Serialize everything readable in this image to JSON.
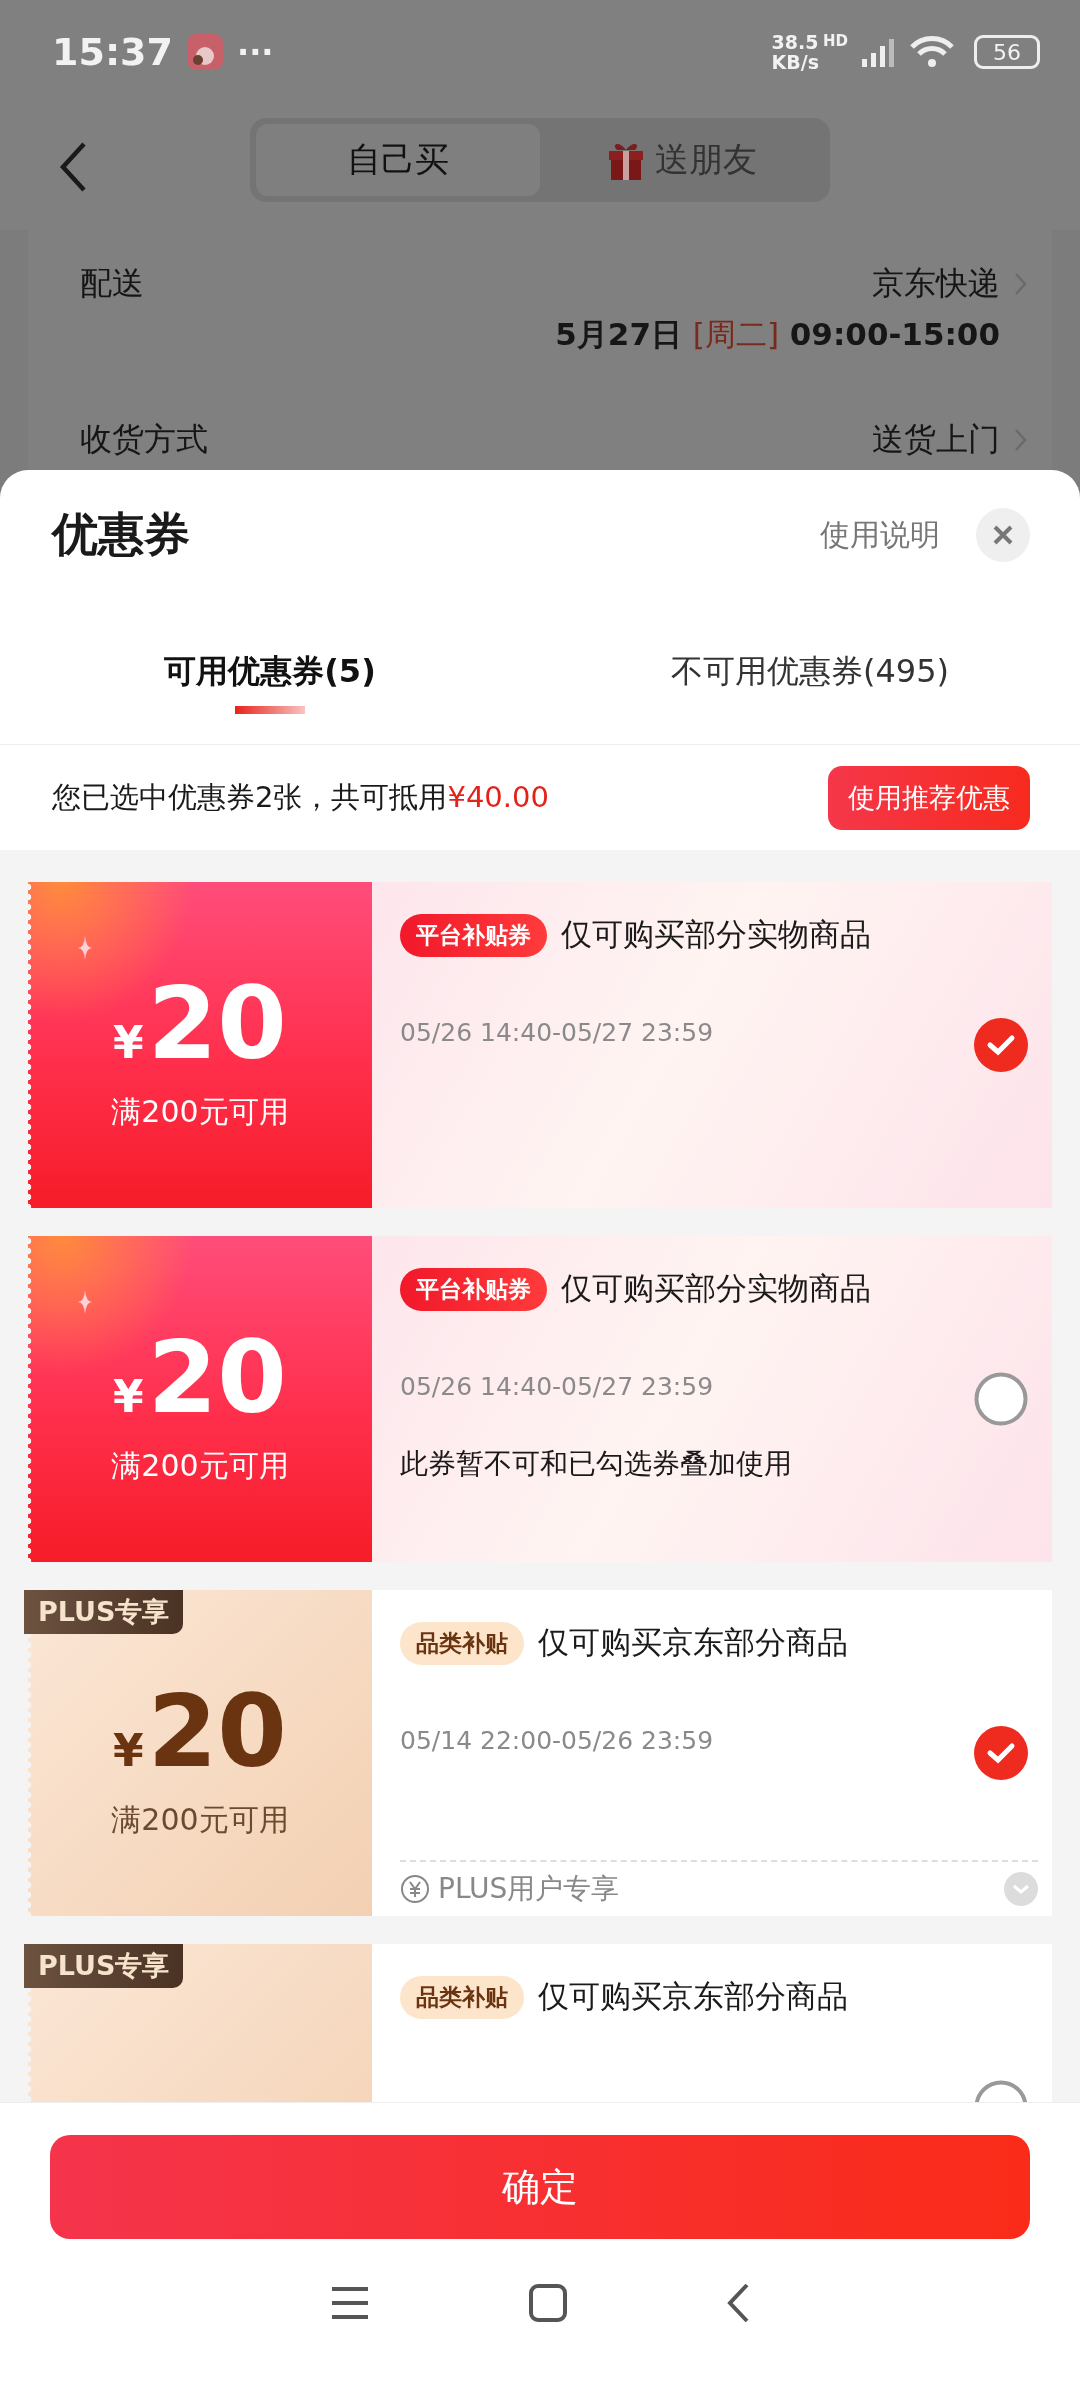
{
  "status_bar": {
    "time": "15:37",
    "more": "···",
    "speed_value": "38.5",
    "speed_unit": "KB/s",
    "network": "HD",
    "battery": "56"
  },
  "background_page": {
    "tabs": [
      {
        "label": "自己买",
        "selected": true,
        "kind": "plain"
      },
      {
        "label": "送朋友",
        "selected": false,
        "kind": "gift"
      }
    ],
    "rows": [
      {
        "label": "配送",
        "value": "京东快递",
        "date": "5月27日",
        "weekday": "[周二]",
        "time": "09:00-15:00"
      },
      {
        "label": "收货方式",
        "value": "送货上门"
      }
    ]
  },
  "sheet": {
    "title": "优惠券",
    "help": "使用说明",
    "tabs": [
      {
        "label": "可用优惠券(5)",
        "selected": true
      },
      {
        "label": "不可用优惠券(495)",
        "selected": false
      }
    ],
    "summary": {
      "text": "您已选中优惠券2张，共可抵用",
      "amount": "¥40.00",
      "button": "使用推荐优惠"
    },
    "coupons": [
      {
        "kind": "platform",
        "currency": "¥",
        "amount": "20",
        "condition": "满200元可用",
        "tag": "平台补贴券",
        "title": "仅可购买部分实物商品",
        "validity": "05/26 14:40-05/27 23:59",
        "selected": true
      },
      {
        "kind": "platform",
        "currency": "¥",
        "amount": "20",
        "condition": "满200元可用",
        "tag": "平台补贴券",
        "title": "仅可购买部分实物商品",
        "validity": "05/26 14:40-05/27 23:59",
        "note": "此券暂不可和已勾选券叠加使用",
        "selected": false
      },
      {
        "kind": "plus",
        "corner": "PLUS专享",
        "currency": "¥",
        "amount": "20",
        "condition": "满200元可用",
        "tag": "品类补贴",
        "title": "仅可购买京东部分商品",
        "validity": "05/14 22:00-05/26 23:59",
        "footer": "PLUS用户专享",
        "selected": true
      },
      {
        "kind": "plus",
        "corner": "PLUS专享",
        "tag": "品类补贴",
        "title": "仅可购买京东部分商品",
        "selected": false
      }
    ],
    "confirm": "确定"
  }
}
